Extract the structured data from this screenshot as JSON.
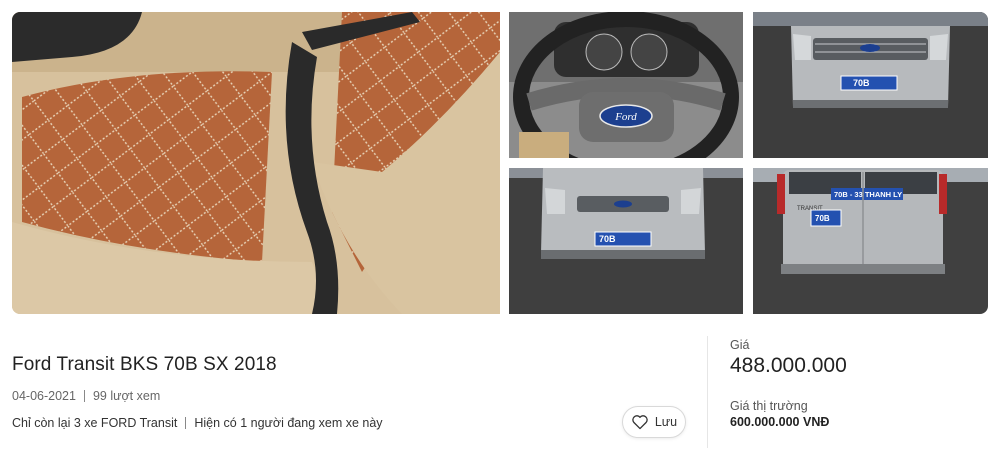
{
  "listing": {
    "title": "Ford Transit BKS 70B SX 2018",
    "date": "04-06-2021",
    "views": "99 lượt xem",
    "stock_note": "Chỉ còn lại 3 xe FORD Transit",
    "viewers_note": "Hiện có 1 người đang xem xe này",
    "save_label": "Lưu"
  },
  "price": {
    "label": "Giá",
    "value": "488.000.000",
    "market_label": "Giá thị trường",
    "market_value": "600.000.000 VNĐ"
  },
  "photos": {
    "wheel_badge": "Ford",
    "plate_front": "70B",
    "plate_rear": "70B",
    "rear_text": "TRANSIT",
    "rear_window_text": "70B - 33 THANH LY"
  },
  "colors": {
    "leather_brown": "#b8693d",
    "seat_beige": "#d8c3a0",
    "van_silver": "#b9bcbf",
    "asphalt": "#3a3a3a",
    "plate_blue": "#1f4aa8"
  }
}
